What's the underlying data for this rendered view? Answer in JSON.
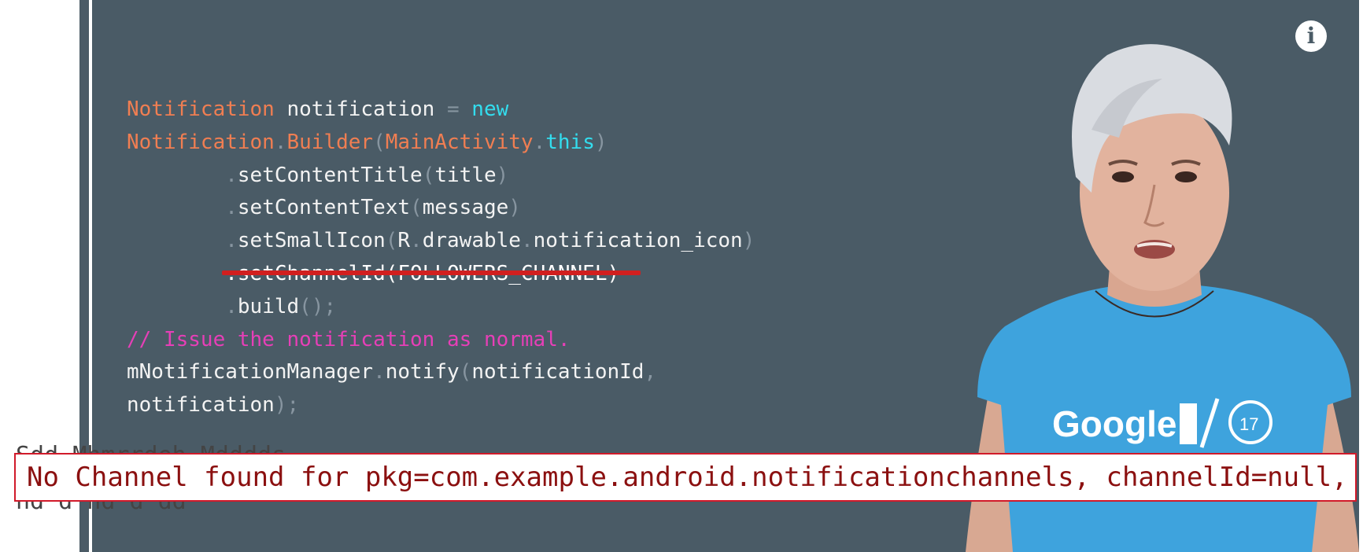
{
  "slide": {
    "background": "#4a5b66",
    "info_button": {
      "label": "i",
      "icon": "info-icon"
    }
  },
  "code": {
    "l1": {
      "type": "Notification",
      "var": " notification ",
      "eq": "=",
      "kw": " new"
    },
    "l2": {
      "cls": "Notification",
      "dot1": ".",
      "builder": "Builder",
      "paren1": "(",
      "ctx": "MainActivity",
      "dot2": ".",
      "this": "this",
      "paren2": ")"
    },
    "l3": {
      "indent": "        ",
      "dot": ".",
      "method": "setContentTitle",
      "open": "(",
      "arg": "title",
      "close": ")"
    },
    "l4": {
      "indent": "        ",
      "dot": ".",
      "method": "setContentText",
      "open": "(",
      "arg": "message",
      "close": ")"
    },
    "l5": {
      "indent": "        ",
      "dot": ".",
      "method": "setSmallIcon",
      "open": "(",
      "r": "R",
      "d1": ".",
      "drawable": "drawable",
      "d2": ".",
      "icon": "notification_icon",
      "close": ")"
    },
    "l6": {
      "indent": "        ",
      "text": ".setChannelId(FOLLOWERS_CHANNEL)"
    },
    "l7": {
      "indent": "        ",
      "dot": ".",
      "method": "build",
      "tail": "();"
    },
    "l8": {
      "comment": "// Issue the notification as normal."
    },
    "l9": {
      "obj": "mNotificationManager",
      "dot": ".",
      "method": "notify",
      "open": "(",
      "arg": "notificationId",
      "comma": ","
    },
    "l10": {
      "arg": "notification",
      "tail": ");"
    }
  },
  "error_banner": {
    "text": "No Channel found for pkg=com.example.android.notificationchannels, channelId=null,",
    "ghost_above": "Sdd Mhmrrdeh Mdddds",
    "ghost_below": "hd d hd d dd",
    "border_color": "#d11a2a",
    "text_color": "#8b1010"
  },
  "presenter": {
    "shirt_text": "Google I/O 17",
    "shirt_color": "#3ea3dd"
  }
}
